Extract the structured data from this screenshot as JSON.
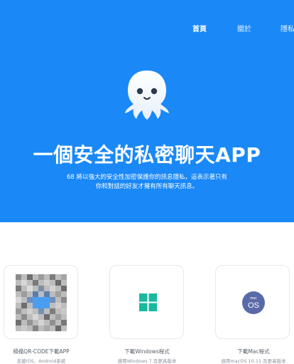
{
  "nav": {
    "items": [
      "首頁",
      "關於",
      "隱私"
    ]
  },
  "hero": {
    "title": "一個安全的私密聊天APP",
    "desc_line1": "68 將以強大的安全性加密保護你的訊息隱私，這表示著只有",
    "desc_line2": "你和對話的好友才擁有所有聊天訊息。"
  },
  "downloads": [
    {
      "icon": "qr-code-icon",
      "label": "掃描QR-CODE下載APP",
      "sub": "支援iOS、Android系統"
    },
    {
      "icon": "windows-icon",
      "label": "下載Windows程式",
      "sub": "適用Windows 7 及更高版本"
    },
    {
      "icon": "macos-icon",
      "label": "下載Mac程式",
      "sub": "適用macOS 10.11 及更高版本"
    }
  ],
  "colors": {
    "brand_blue": "#1a88f7",
    "windows_teal": "#19b8a0",
    "mac_purple": "#5a6aa8"
  }
}
